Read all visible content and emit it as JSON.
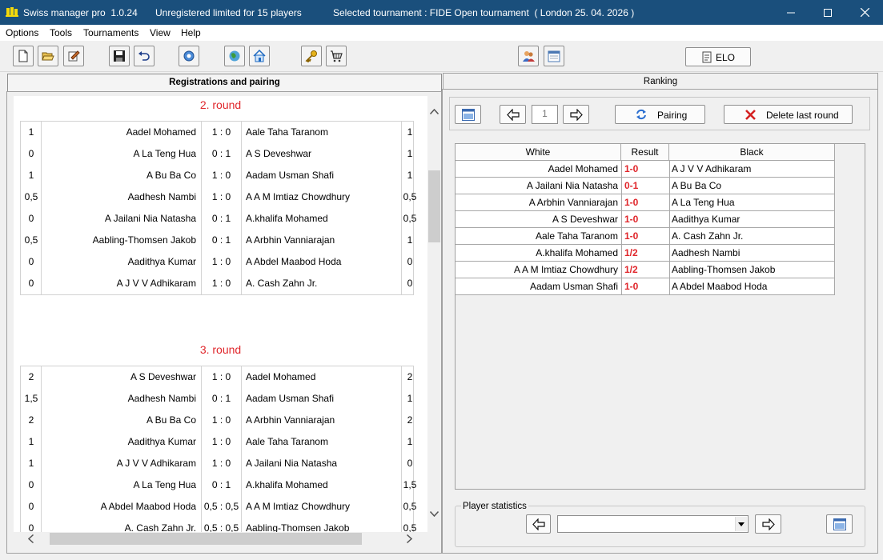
{
  "window": {
    "app_title": "Swiss manager pro  1.0.24",
    "license_text": "Unregistered limited for 15 players",
    "tournament_text": "Selected tournament : FIDE Open tournament  ( London 25. 04. 2026 )"
  },
  "menu": [
    "Options",
    "Tools",
    "Tournaments",
    "View",
    "Help"
  ],
  "toolbar": {
    "icons": [
      "new-document-icon",
      "open-folder-icon",
      "edit-tournament-icon",
      "save-icon",
      "undo-icon",
      "settings-gear-icon",
      "globe-icon",
      "home-icon",
      "key-icon",
      "shopping-cart-icon",
      "players-icon",
      "calendar-window-icon"
    ],
    "elo_label": "ELO"
  },
  "tabs": {
    "left": "Registrations and pairing",
    "right": "Ranking"
  },
  "rounds": [
    {
      "title": "2. round",
      "games": [
        {
          "pw": "1",
          "white": "Aadel Mohamed",
          "result": "1 : 0",
          "black": "Aale Taha Taranom",
          "pb": "1"
        },
        {
          "pw": "0",
          "white": "A La Teng Hua",
          "result": "0 : 1",
          "black": "A S Deveshwar",
          "pb": "1"
        },
        {
          "pw": "1",
          "white": "A Bu Ba Co",
          "result": "1 : 0",
          "black": "Aadam Usman Shafi",
          "pb": "1"
        },
        {
          "pw": "0,5",
          "white": "Aadhesh Nambi",
          "result": "1 : 0",
          "black": "A A M Imtiaz Chowdhury",
          "pb": "0,5"
        },
        {
          "pw": "0",
          "white": "A Jailani Nia Natasha",
          "result": "0 : 1",
          "black": "A.khalifa Mohamed",
          "pb": "0,5"
        },
        {
          "pw": "0,5",
          "white": "Aabling-Thomsen Jakob",
          "result": "0 : 1",
          "black": "A Arbhin Vanniarajan",
          "pb": "1"
        },
        {
          "pw": "0",
          "white": "Aadithya Kumar",
          "result": "1 : 0",
          "black": "A Abdel Maabod Hoda",
          "pb": "0"
        },
        {
          "pw": "0",
          "white": "A J V V Adhikaram",
          "result": "1 : 0",
          "black": "A. Cash Zahn Jr.",
          "pb": "0"
        }
      ]
    },
    {
      "title": "3. round",
      "games": [
        {
          "pw": "2",
          "white": "A S Deveshwar",
          "result": "1 : 0",
          "black": "Aadel Mohamed",
          "pb": "2"
        },
        {
          "pw": "1,5",
          "white": "Aadhesh Nambi",
          "result": "0 : 1",
          "black": "Aadam Usman Shafi",
          "pb": "1"
        },
        {
          "pw": "2",
          "white": "A Bu Ba Co",
          "result": "1 : 0",
          "black": "A Arbhin Vanniarajan",
          "pb": "2"
        },
        {
          "pw": "1",
          "white": "Aadithya Kumar",
          "result": "1 : 0",
          "black": "Aale Taha Taranom",
          "pb": "1"
        },
        {
          "pw": "1",
          "white": "A J V V Adhikaram",
          "result": "1 : 0",
          "black": "A Jailani Nia Natasha",
          "pb": "0"
        },
        {
          "pw": "0",
          "white": "A La Teng Hua",
          "result": "0 : 1",
          "black": "A.khalifa Mohamed",
          "pb": "1,5"
        },
        {
          "pw": "0",
          "white": "A Abdel Maabod Hoda",
          "result": "0,5 : 0,5",
          "black": "A A M Imtiaz Chowdhury",
          "pb": "0,5"
        },
        {
          "pw": "0",
          "white": "A. Cash Zahn Jr.",
          "result": "0,5 : 0,5",
          "black": "Aabling-Thomsen Jakob",
          "pb": "0,5"
        }
      ]
    }
  ],
  "pairing_panel": {
    "round_number": "1",
    "pairing_label": "Pairing",
    "delete_label": "Delete last round",
    "headers": {
      "white": "White",
      "result": "Result",
      "black": "Black"
    },
    "result_color": "#e0262b",
    "rows": [
      {
        "white": "Aadel Mohamed",
        "result": "1-0",
        "black": "A J V V Adhikaram"
      },
      {
        "white": "A Jailani Nia Natasha",
        "result": "0-1",
        "black": "A Bu Ba Co"
      },
      {
        "white": "A Arbhin Vanniarajan",
        "result": "1-0",
        "black": "A La Teng Hua"
      },
      {
        "white": "A S Deveshwar",
        "result": "1-0",
        "black": "Aadithya Kumar"
      },
      {
        "white": "Aale Taha Taranom",
        "result": "1-0",
        "black": "A. Cash Zahn Jr."
      },
      {
        "white": "A.khalifa Mohamed",
        "result": "1/2",
        "black": "Aadhesh Nambi"
      },
      {
        "white": "A A M Imtiaz Chowdhury",
        "result": "1/2",
        "black": "Aabling-Thomsen Jakob"
      },
      {
        "white": "Aadam Usman Shafi",
        "result": "1-0",
        "black": "A Abdel Maabod Hoda"
      }
    ]
  },
  "player_statistics": {
    "label": "Player statistics",
    "selected": ""
  }
}
